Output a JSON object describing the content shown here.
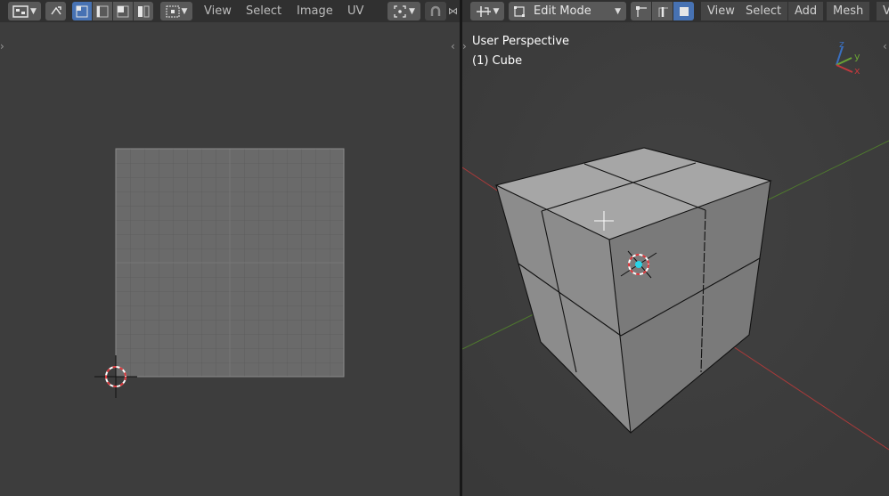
{
  "uv_editor": {
    "header": {
      "mode_icon": "uv-editor-type-icon",
      "sync_icon": "uv-sync-icon",
      "select_modes": [
        "vertex-select-icon",
        "edge-select-icon",
        "face-select-icon",
        "island-select-icon"
      ],
      "sticky_icon": "sticky-select-icon",
      "menus": [
        "View",
        "Select",
        "Image",
        "UV"
      ],
      "pivot_icon": "pivot-point-icon",
      "snap_icon": "snap-magnet-icon"
    }
  },
  "viewport": {
    "header": {
      "transform_icon": "transform-orientation-icon",
      "mode_label": "Edit Mode",
      "select_modes": [
        "vertex-select-icon",
        "edge-select-icon",
        "face-select-icon"
      ],
      "menus": [
        "View",
        "Select",
        "Add",
        "Mesh",
        "V"
      ]
    },
    "overlay": {
      "perspective": "User Perspective",
      "object": "(1) Cube"
    },
    "gizmo": {
      "z": "z",
      "y": "y",
      "x": "x"
    }
  },
  "colors": {
    "active_button": "#4772b3",
    "header_bg": "#303030",
    "editor_bg": "#3d3d3d",
    "x_axis": "#a83a3a",
    "y_axis": "#4f7a2e",
    "selected_vertex": "#29d3e6"
  }
}
